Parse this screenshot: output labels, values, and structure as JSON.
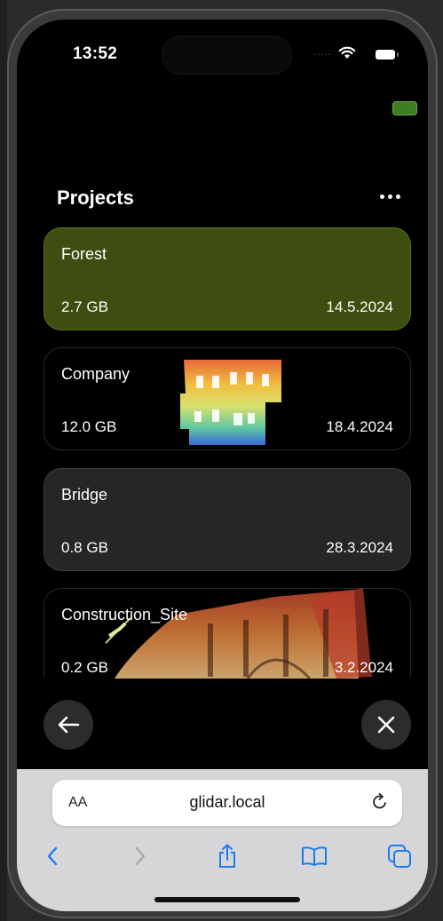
{
  "status": {
    "time": "13:52",
    "dots": "....."
  },
  "header": {
    "title": "Projects"
  },
  "projects": [
    {
      "name": "Forest",
      "size": "2.7 GB",
      "date": "14.5.2024",
      "style": "selected"
    },
    {
      "name": "Company",
      "size": "12.0 GB",
      "date": "18.4.2024",
      "style": "thumbnail"
    },
    {
      "name": "Bridge",
      "size": "0.8 GB",
      "date": "28.3.2024",
      "style": "plain"
    },
    {
      "name": "Construction_Site",
      "size": "0.2 GB",
      "date": "3.2.2024",
      "style": "thumbnail"
    }
  ],
  "safari": {
    "aa": "AA",
    "url": "glidar.local"
  },
  "colors": {
    "selected": "#3d4e10",
    "card": "#262626",
    "accent": "#1a7cf2",
    "indicator": "#3e7d22"
  },
  "icons": {
    "back": "arrow-left-icon",
    "close": "close-icon",
    "more": "ellipsis-icon",
    "reload": "reload-icon",
    "share": "share-icon",
    "bookmarks": "book-icon",
    "tabs": "tabs-icon"
  }
}
